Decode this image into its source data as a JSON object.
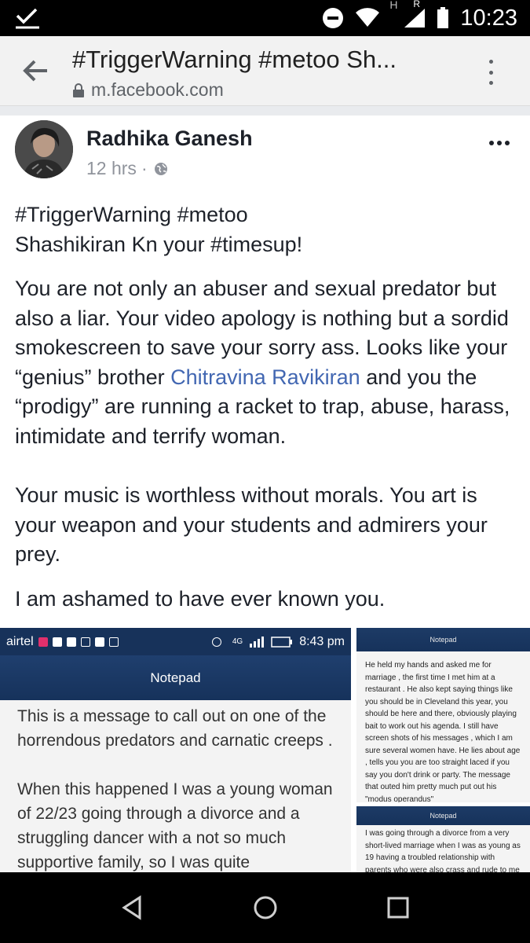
{
  "status_bar": {
    "time": "10:23",
    "network_h": "H",
    "network_r": "R",
    "icons": [
      "checkmark-icon",
      "do-not-disturb-icon",
      "wifi-icon",
      "cell-signal-icon",
      "battery-icon"
    ]
  },
  "browser": {
    "page_title": "#TriggerWarning #metoo Sh...",
    "url": "m.facebook.com"
  },
  "post": {
    "author": "Radhika Ganesh",
    "time": "12 hrs",
    "separator": "·",
    "paragraph_1_line_1": "#TriggerWarning #metoo",
    "paragraph_1_line_2": "Shashikiran Kn your #timesup!",
    "paragraph_2_before": "You are not only an abuser and sexual predator but also a liar. Your video apology is nothing but a sordid smokescreen to save your sorry ass. Looks like your “genius” brother ",
    "paragraph_2_link": "Chitravina Ravikiran",
    "paragraph_2_after": " and you the “prodigy” are running a racket to trap, abuse, harass, intimidate and terrify woman.",
    "paragraph_3": "Your music is worthless without morals. You art is your weapon and your students and admirers your prey.",
    "paragraph_4": "I am ashamed to have ever known you.",
    "link_color": "#4267b2"
  },
  "attachment_main": {
    "carrier": "airtel",
    "network": "4G",
    "time": "8:43 pm",
    "title": "Notepad",
    "paragraph_1": "This is a message to call out on one of the horrendous predators and carnatic creeps .",
    "paragraph_2": "When this happened I was a young woman of 22/23 going through a divorce and a struggling dancer  with a not so much supportive family, so I was quite"
  },
  "attachment_side_1": {
    "title": "Notepad",
    "text": "He held my hands and asked me for marriage , the first time I met him at a restaurant . He also kept saying things like you should be in Cleveland this year, you should be here and there, obviously playing bait to work out his agenda. I still have screen shots of his messages , which I am sure several women have. He lies about age , tells you you are too straight laced if you say you don't drink or party. The message that outed him pretty much put out his \"modus operandus\""
  },
  "attachment_side_2": {
    "title": "Notepad",
    "text": "I was going through a divorce from a very short-lived marriage when I was as young as 19 having a troubled relationship with parents who were also crass and rude to me"
  }
}
